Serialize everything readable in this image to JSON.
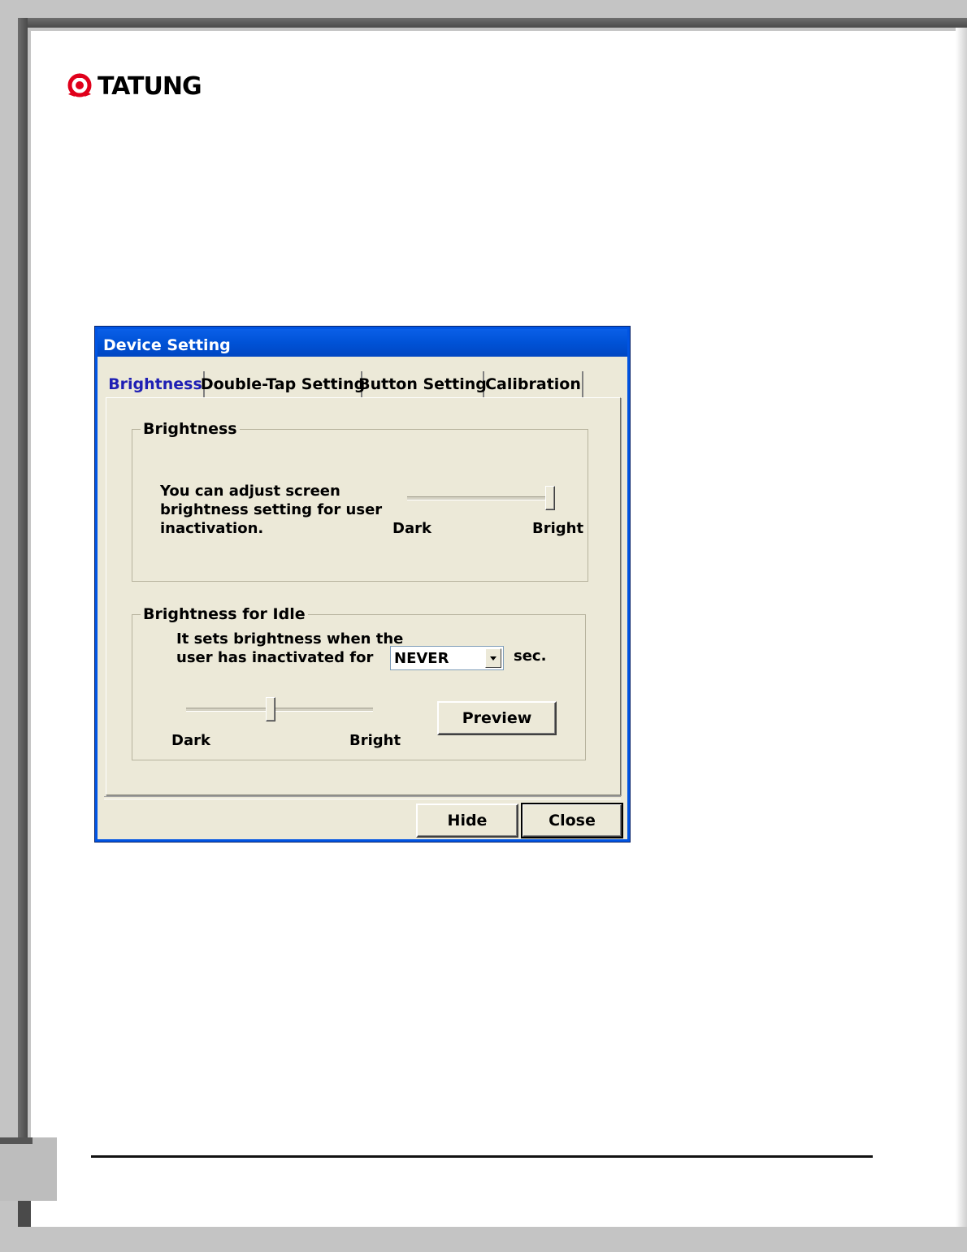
{
  "logo": {
    "brand": "TATUNG",
    "icon": "tatung-logo-icon",
    "color": "#e0001b"
  },
  "dialog": {
    "title": "Device Setting",
    "tabs": [
      {
        "label": "Brightness",
        "active": true
      },
      {
        "label": "Double-Tap Setting",
        "active": false
      },
      {
        "label": "Button Setting",
        "active": false
      },
      {
        "label": "Calibration",
        "active": false
      }
    ],
    "brightness_group": {
      "title": "Brightness",
      "description_lines": [
        "You can adjust screen",
        "brightness setting for user",
        "inactivation."
      ],
      "slider": {
        "min_label": "Dark",
        "max_label": "Bright",
        "value_fraction": 1.0
      }
    },
    "idle_group": {
      "title": "Brightness for Idle",
      "description_lines": [
        "It sets brightness when the",
        "user has inactivated for"
      ],
      "timeout_select": {
        "value": "NEVER"
      },
      "unit": "sec.",
      "slider": {
        "min_label": "Dark",
        "max_label": "Bright",
        "value_fraction": 0.45
      },
      "preview_label": "Preview"
    },
    "footer": {
      "hide_label": "Hide",
      "close_label": "Close"
    }
  }
}
